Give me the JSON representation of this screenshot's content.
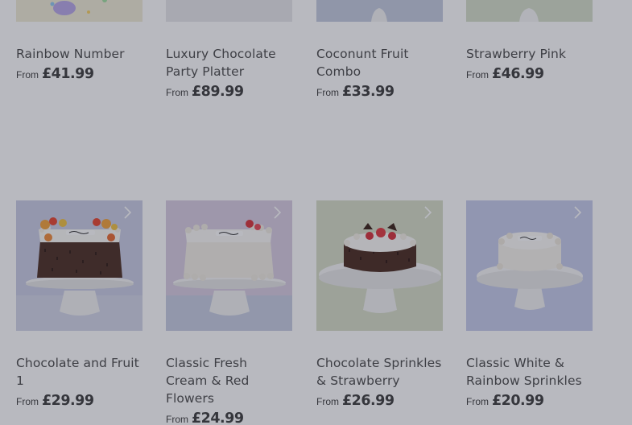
{
  "currency_prefix": "From",
  "row1": [
    {
      "name": "Rainbow Number",
      "price": "£41.99"
    },
    {
      "name": "Luxury Chocolate Party Platter",
      "price": "£89.99"
    },
    {
      "name": "Coconunt Fruit Combo",
      "price": "£33.99"
    },
    {
      "name": "Strawberry Pink",
      "price": "£46.99"
    }
  ],
  "row2": [
    {
      "name": "Chocolate and Fruit 1",
      "price": "£29.99",
      "bg": "#c9cde4",
      "cake": "chocolate-fruit"
    },
    {
      "name": "Classic Fresh Cream & Red Flowers",
      "price": "£24.99",
      "bg": "#d8cde2",
      "cake": "cream-flowers"
    },
    {
      "name": "Chocolate Sprinkles & Strawberry",
      "price": "£26.99",
      "bg": "#d7ddc6",
      "cake": "chocolate-strawberry"
    },
    {
      "name": "Classic White & Rainbow Sprinkles",
      "price": "£20.99",
      "bg": "#c5cbea",
      "cake": "white-round"
    }
  ],
  "icons": {
    "chevron": "chevron-right-icon"
  },
  "overlay_color": "#282c3c"
}
